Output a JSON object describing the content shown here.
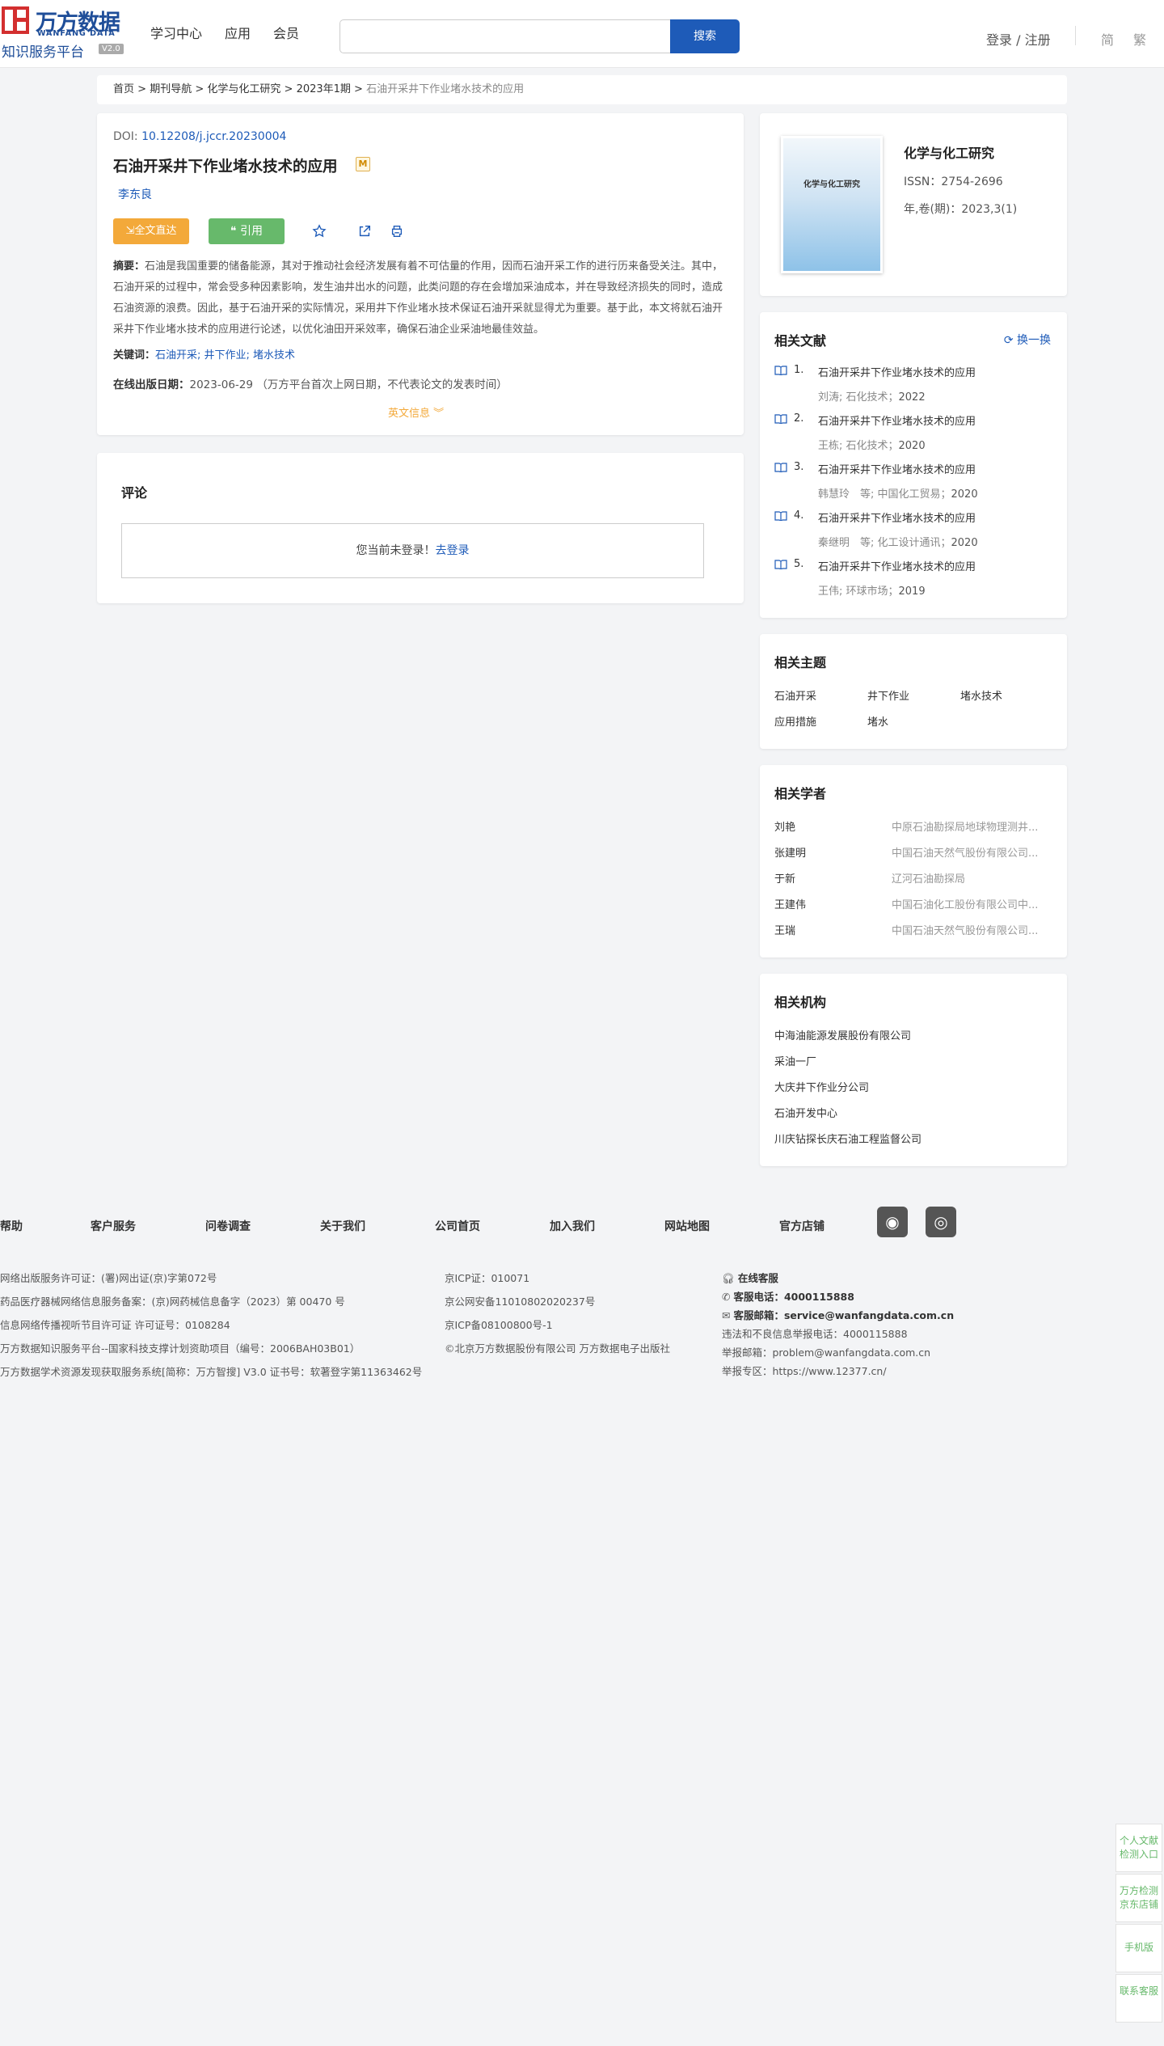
{
  "header": {
    "logo_cn": "万方数据",
    "logo_en": "WANFANG DATA",
    "logo_sub": "知识服务平台",
    "logo_version": "V2.0",
    "nav": [
      "学习中心",
      "应用",
      "会员"
    ],
    "search_placeholder": "",
    "search_button": "搜索",
    "login": "登录 / 注册",
    "lang_simplified": "简",
    "lang_traditional": "繁"
  },
  "breadcrumb": {
    "items": [
      "首页",
      "期刊导航",
      "化学与化工研究",
      "2023年1期"
    ],
    "separator": " > ",
    "current": "石油开采井下作业堵水技术的应用"
  },
  "article": {
    "doi_label": "DOI: ",
    "doi": "10.12208/j.jccr.20230004",
    "title": "石油开采井下作业堵水技术的应用",
    "badge": "M",
    "author": "李东良",
    "fulltext_button": "全文直达",
    "cite_button": "引用",
    "abstract_label": "摘要：",
    "abstract": "石油是我国重要的储备能源，其对于推动社会经济发展有着不可估量的作用，因而石油开采工作的进行历来备受关注。其中，石油开采的过程中，常会受多种因素影响，发生油井出水的问题，此类问题的存在会增加采油成本，并在导致经济损失的同时，造成石油资源的浪费。因此，基于石油开采的实际情况，采用井下作业堵水技术保证石油开采就显得尤为重要。基于此，本文将就石油开采井下作业堵水技术的应用进行论述，以优化油田开采效率，确保石油企业采油地最佳效益。",
    "keywords_label": "关键词：",
    "keywords": "石油开采; 井下作业; 堵水技术",
    "pubdate_label": "在线出版日期：",
    "pubdate": "2023-06-29",
    "pubdate_note": "（万方平台首次上网日期，不代表论文的发表时间）",
    "en_info": "英文信息"
  },
  "comment": {
    "heading": "评论",
    "prompt": "您当前未登录！",
    "login_link": "去登录"
  },
  "journal": {
    "cover_title": "化学与化工研究",
    "name": "化学与化工研究",
    "issn": "ISSN：2754-2696",
    "volume": "年,卷(期)：2023,3(1)"
  },
  "related_docs": {
    "heading": "相关文献",
    "refresh": "换一换",
    "items": [
      {
        "num": "1.",
        "title": "石油开采井下作业堵水技术的应用",
        "meta": "刘涛; 石化技术；",
        "year": "2022"
      },
      {
        "num": "2.",
        "title": "石油开采井下作业堵水技术的应用",
        "meta": "王栋; 石化技术；",
        "year": "2020"
      },
      {
        "num": "3.",
        "title": "石油开采井下作业堵水技术的应用",
        "meta": "韩慧玲　等; 中国化工贸易；",
        "year": "2020"
      },
      {
        "num": "4.",
        "title": "石油开采井下作业堵水技术的应用",
        "meta": "秦继明　等; 化工设计通讯；",
        "year": "2020"
      },
      {
        "num": "5.",
        "title": "石油开采井下作业堵水技术的应用",
        "meta": "王伟; 环球市场；",
        "year": "2019"
      }
    ]
  },
  "related_topics": {
    "heading": "相关主题",
    "items": [
      "石油开采",
      "井下作业",
      "堵水技术",
      "应用措施",
      "堵水"
    ]
  },
  "related_scholars": {
    "heading": "相关学者",
    "items": [
      {
        "name": "刘艳",
        "org": "中原石油勘探局地球物理测井..."
      },
      {
        "name": "张建明",
        "org": "中国石油天然气股份有限公司..."
      },
      {
        "name": "于新",
        "org": "辽河石油勘探局"
      },
      {
        "name": "王建伟",
        "org": "中国石油化工股份有限公司中..."
      },
      {
        "name": "王瑞",
        "org": "中国石油天然气股份有限公司..."
      }
    ]
  },
  "related_institutions": {
    "heading": "相关机构",
    "items": [
      "中海油能源发展股份有限公司",
      "采油一厂",
      "大庆井下作业分公司",
      "石油开发中心",
      "川庆钻探长庆石油工程监督公司"
    ]
  },
  "footer": {
    "nav": [
      "帮助",
      "客户服务",
      "问卷调查",
      "关于我们",
      "公司首页",
      "加入我们",
      "网站地图",
      "官方店铺"
    ],
    "col1": [
      "网络出版服务许可证：(署)网出证(京)字第072号",
      "药品医疗器械网络信息服务备案：(京)网药械信息备字（2023）第 00470 号",
      "信息网络传播视听节目许可证 许可证号：0108284",
      "万方数据知识服务平台--国家科技支撑计划资助项目（编号：2006BAH03B01）",
      "万方数据学术资源发现获取服务系统[简称：万方智搜] V3.0 证书号：软著登字第11363462号"
    ],
    "col2": [
      "京ICP证：010071",
      "京公网安备11010802020237号",
      "京ICP备08100800号-1",
      "©北京万方数据股份有限公司 万方数据电子出版社"
    ],
    "col3": {
      "online_service": "在线客服",
      "phone_label": "客服电话：",
      "phone": "4000115888",
      "email_label": "客服邮箱：",
      "email": "service@wanfangdata.com.cn",
      "report_phone": "违法和不良信息举报电话：4000115888",
      "report_email": "举报邮箱：problem@wanfangdata.com.cn",
      "report_zone": "举报专区：https://www.12377.cn/"
    }
  },
  "float_bar": {
    "items": [
      "个人文献检测入口",
      "万方检测京东店铺",
      "手机版",
      "联系客服"
    ]
  }
}
